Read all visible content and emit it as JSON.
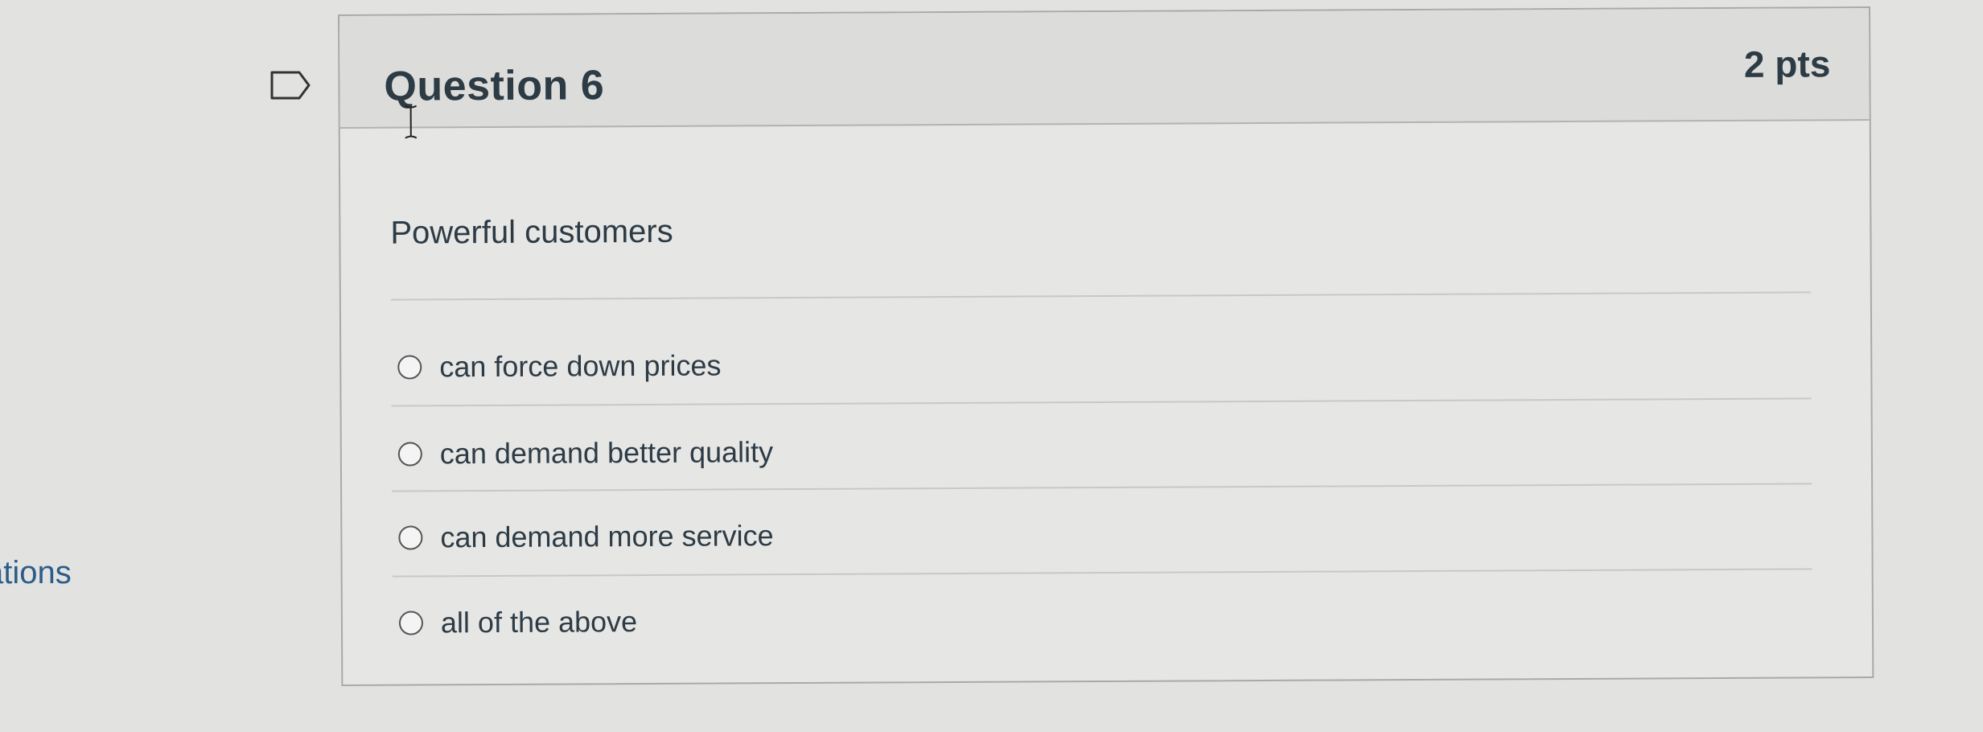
{
  "sidebar": {
    "partial_link": "ations"
  },
  "question": {
    "title": "Question 6",
    "points": "2 pts",
    "text": "Powerful customers",
    "answers": [
      {
        "label": "can force down prices"
      },
      {
        "label": "can demand better quality"
      },
      {
        "label": "can demand more service"
      },
      {
        "label": "all of the above"
      }
    ]
  },
  "colors": {
    "background": "#e2e2e1",
    "card_header": "#dcdcdb",
    "text": "#2d3b45",
    "link": "#2b5d88"
  },
  "icons": {
    "flag": "flag-icon",
    "radio": "radio-button-icon",
    "cursor": "text-cursor-icon"
  }
}
